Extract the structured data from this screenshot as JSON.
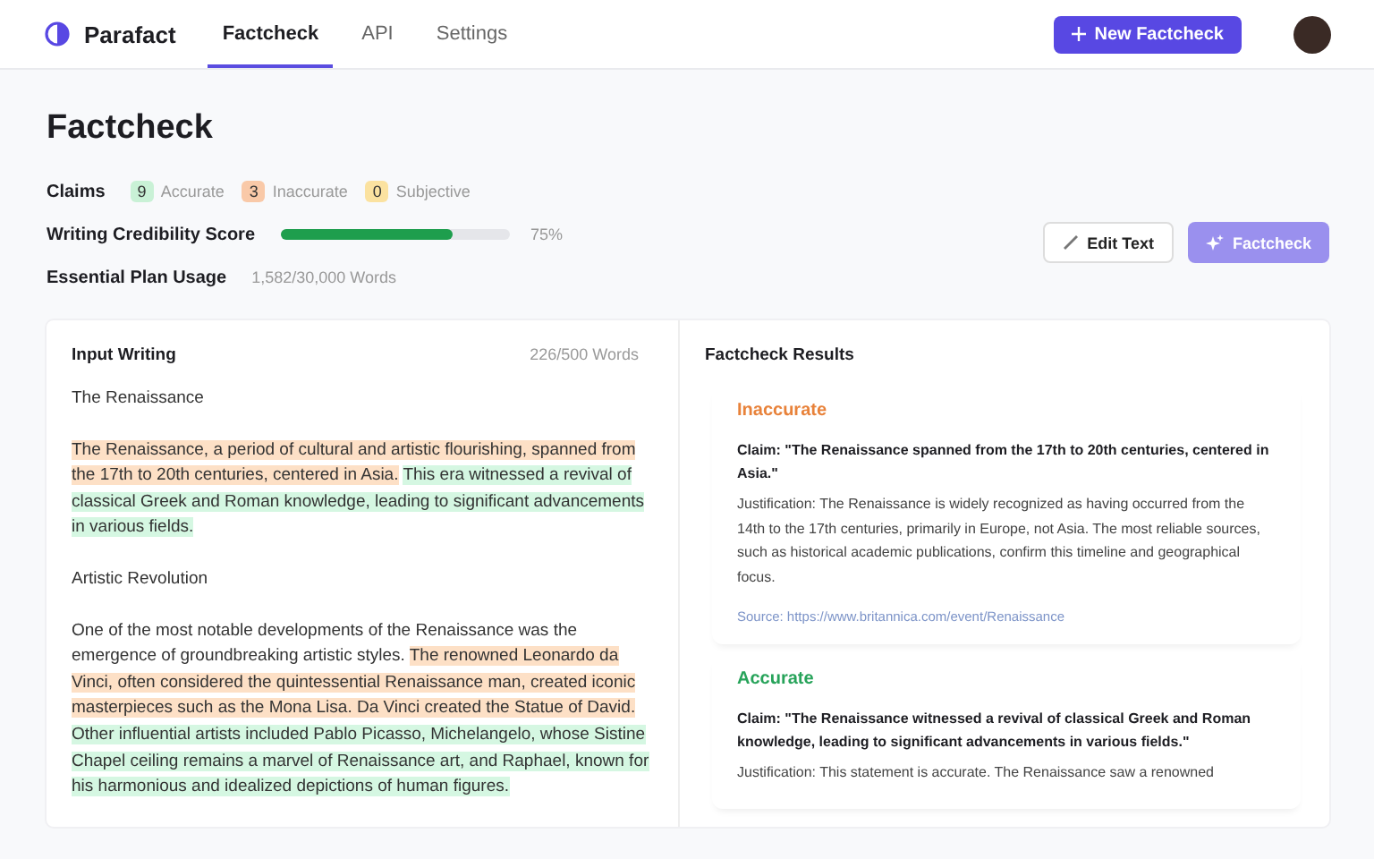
{
  "nav": {
    "brand": "Parafact",
    "tabs": [
      {
        "label": "Factcheck",
        "selected": true
      },
      {
        "label": "API",
        "selected": false
      },
      {
        "label": "Settings",
        "selected": false
      }
    ],
    "new_button": "New Factcheck"
  },
  "page": {
    "title": "Factcheck"
  },
  "claims": {
    "label": "Claims",
    "counts": [
      {
        "count": "9",
        "label": "Accurate",
        "kind": "accurate"
      },
      {
        "count": "3",
        "label": "Inaccurate",
        "kind": "inaccurate"
      },
      {
        "count": "0",
        "label": "Subjective",
        "kind": "subjective"
      }
    ]
  },
  "score": {
    "label": "Writing Credibility Score",
    "level": 0.75,
    "reading": "75%"
  },
  "usage": {
    "label": "Essential Plan Usage",
    "value": "1,582/30,000 Words"
  },
  "actions": [
    {
      "label": "Edit Text",
      "kind": "edit",
      "disabled": false
    },
    {
      "label": "Factcheck",
      "kind": "factcheck",
      "disabled": true
    }
  ],
  "input": {
    "title": "Input Writing",
    "count": "226/500 Words",
    "paragraphs": [
      [
        {
          "text": "The Renaissance",
          "kind": "plain"
        }
      ],
      [
        {
          "text": "The Renaissance, a period of cultural and artistic flourishing, spanned from the 17th to 20th centuries, centered in Asia.",
          "kind": "inaccurate"
        },
        {
          "text": "This era witnessed a revival of classical Greek and Roman knowledge, leading to significant advancements in various fields.",
          "kind": "accurate"
        }
      ],
      [
        {
          "text": "Artistic Revolution",
          "kind": "plain"
        }
      ],
      [
        {
          "text": "One of the most notable developments of the Renaissance was the emergence of groundbreaking artistic styles.",
          "kind": "plain"
        },
        {
          "text": "The renowned Leonardo da Vinci, often considered the quintessential Renaissance man, created iconic masterpieces such as the Mona Lisa. Da Vinci created the Statue of David.",
          "kind": "inaccurate"
        },
        {
          "text": "Other influential artists included Pablo Picasso, Michelangelo, whose Sistine Chapel ceiling remains a marvel of Renaissance art, and Raphael, known for his harmonious and idealized depictions of human figures.",
          "kind": "accurate"
        }
      ]
    ]
  },
  "results": {
    "title": "Factcheck Results",
    "items": [
      {
        "verdict": "Inaccurate",
        "kind": "inaccurate",
        "claim": "Claim: \"The Renaissance spanned from the 17th to 20th centuries, centered in Asia.\"",
        "justification": "Justification: The Renaissance is widely recognized as having occurred from the 14th to the 17th centuries, primarily in Europe, not Asia. The most reliable sources, such as historical academic publications, confirm this timeline and geographical focus.",
        "source": "Source: https://www.britannica.com/event/Renaissance"
      },
      {
        "verdict": "Accurate",
        "kind": "accurate",
        "claim": "Claim: \"The Renaissance witnessed a revival of classical Greek and Roman knowledge, leading to significant advancements in various fields.\"",
        "justification": "Justification: This statement is accurate. The Renaissance saw a renowned"
      }
    ]
  }
}
